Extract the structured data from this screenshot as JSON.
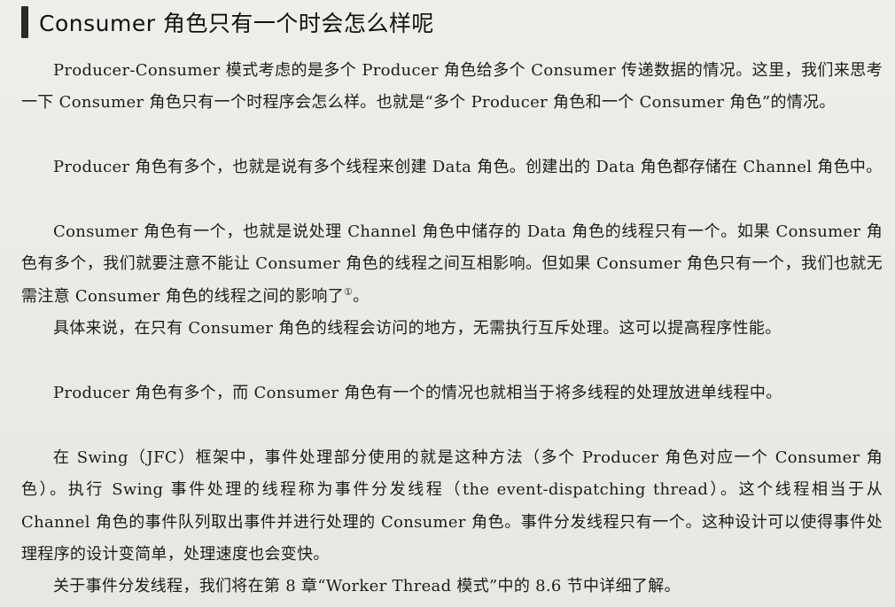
{
  "heading": "Consumer 角色只有一个时会怎么样呢",
  "paragraphs": {
    "p1": "Producer-Consumer 模式考虑的是多个 Producer 角色给多个 Consumer 传递数据的情况。这里，我们来思考一下 Consumer 角色只有一个时程序会怎么样。也就是“多个 Producer 角色和一个 Consumer 角色”的情况。",
    "p2": "Producer 角色有多个，也就是说有多个线程来创建 Data 角色。创建出的 Data 角色都存储在 Channel 角色中。",
    "p3": "Consumer 角色有一个，也就是说处理 Channel 角色中储存的 Data 角色的线程只有一个。如果 Consumer 角色有多个，我们就要注意不能让 Consumer 角色的线程之间互相影响。但如果 Consumer 角色只有一个，我们也就无需注意 Consumer 角色的线程之间的影响了",
    "p3_footnote": "①",
    "p3_end": "。",
    "p4": "具体来说，在只有 Consumer 角色的线程会访问的地方，无需执行互斥处理。这可以提高程序性能。",
    "p5": "Producer 角色有多个，而 Consumer 角色有一个的情况也就相当于将多线程的处理放进单线程中。",
    "p6": "在 Swing（JFC）框架中，事件处理部分使用的就是这种方法（多个 Producer 角色对应一个 Consumer 角色）。执行 Swing 事件处理的线程称为事件分发线程（the event-dispatching thread）。这个线程相当于从 Channel 角色的事件队列取出事件并进行处理的 Consumer 角色。事件分发线程只有一个。这种设计可以使得事件处理程序的设计变简单，处理速度也会变快。",
    "p7": "关于事件分发线程，我们将在第 8 章“Worker Thread 模式”中的 8.6 节中详细了解。"
  }
}
